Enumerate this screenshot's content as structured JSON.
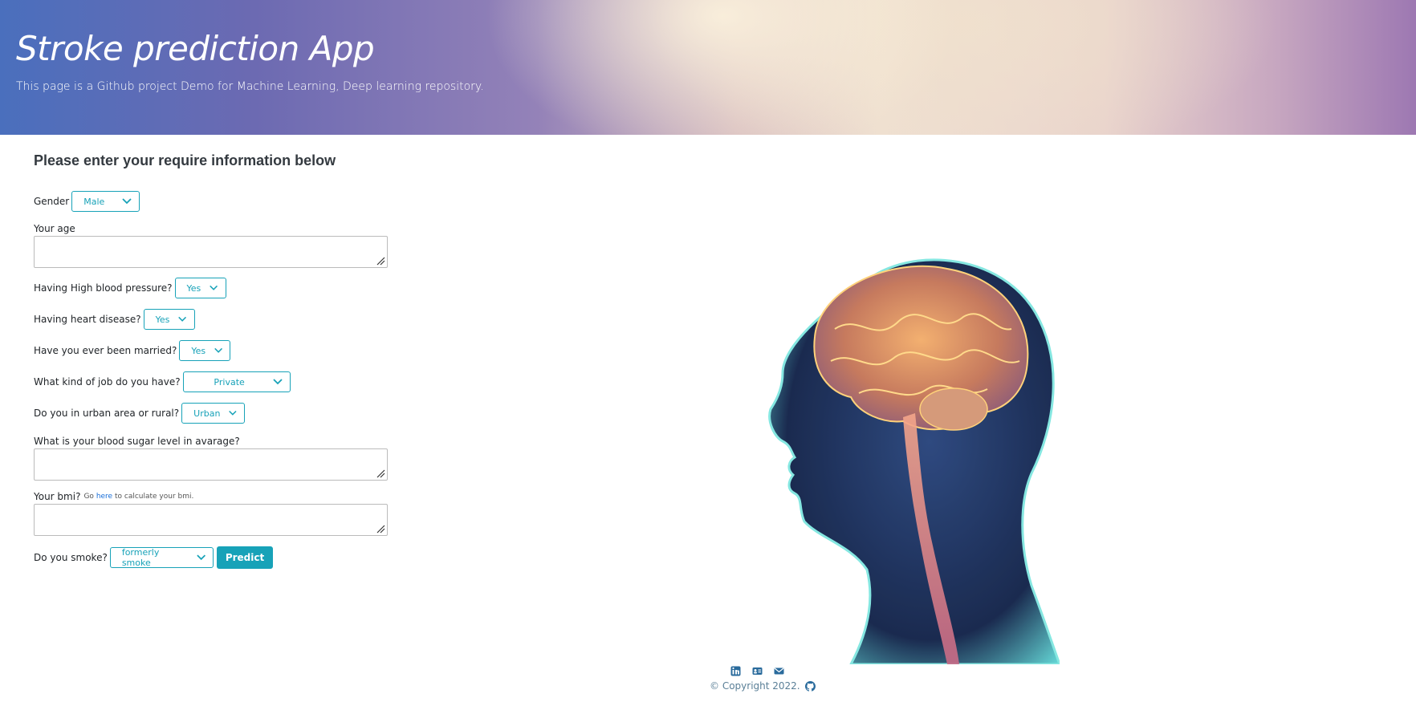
{
  "hero": {
    "title": "Stroke prediction App",
    "subtitle": "This page is a Github project Demo for Machine Learning, Deep learning repository."
  },
  "form": {
    "heading": "Please enter your require information below",
    "gender": {
      "label": "Gender",
      "value": "Male"
    },
    "age": {
      "label": "Your age",
      "value": ""
    },
    "hypertension": {
      "label": "Having High blood pressure?",
      "value": "Yes"
    },
    "heart_disease": {
      "label": "Having heart disease?",
      "value": "Yes"
    },
    "married": {
      "label": "Have you ever been married?",
      "value": "Yes"
    },
    "job": {
      "label": "What kind of job do you have?",
      "value": "Private"
    },
    "residence": {
      "label": "Do you in urban area or rural?",
      "value": "Urban"
    },
    "glucose": {
      "label": "What is your blood sugar level in avarage?",
      "value": ""
    },
    "bmi": {
      "label": "Your bmi?",
      "hint_prefix": "Go",
      "hint_link": "here",
      "hint_suffix": "to calculate your bmi.",
      "value": ""
    },
    "smoke": {
      "label": "Do you smoke?",
      "value": "formerly smoke"
    },
    "predict_label": "Predict"
  },
  "footer": {
    "icons": [
      "linkedin-icon",
      "contact-card-icon",
      "mail-icon"
    ],
    "copyright": "© Copyright 2022.",
    "github_icon": "github-icon"
  },
  "colors": {
    "accent": "#17a2b8",
    "footer_text": "#5a7f97"
  }
}
